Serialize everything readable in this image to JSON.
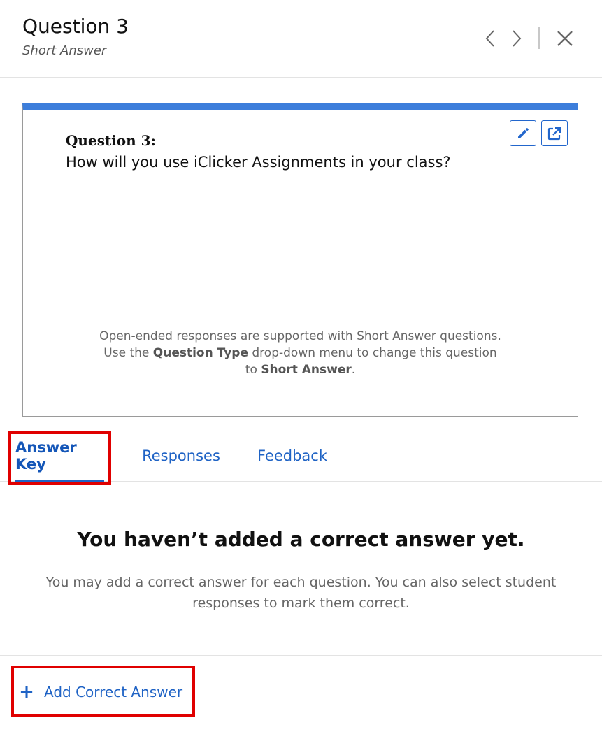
{
  "header": {
    "title": "Question 3",
    "subtitle": "Short Answer",
    "icons": {
      "prev": "chevron-left-icon",
      "next": "chevron-right-icon",
      "close": "close-icon"
    }
  },
  "preview": {
    "question_label": "Question 3:",
    "question_text": "How will you use iClicker Assignments in your class?",
    "note_line1": "Open-ended responses are supported with Short Answer questions.",
    "note_line2_a": "Use the ",
    "note_line2_b": "Question Type",
    "note_line2_c": " drop-down menu to change this question",
    "note_line3_a": "to ",
    "note_line3_b": "Short Answer",
    "note_line3_c": ".",
    "icons": {
      "edit": "pencil-icon",
      "open": "external-link-icon"
    },
    "accent_color": "#3d7edb"
  },
  "tabs": [
    {
      "label": "Answer Key",
      "active": true
    },
    {
      "label": "Responses",
      "active": false
    },
    {
      "label": "Feedback",
      "active": false
    }
  ],
  "empty_state": {
    "title": "You haven’t added a correct answer yet.",
    "description": "You may add a correct answer for each question. You can also select student responses to mark them correct."
  },
  "footer": {
    "add_label": "Add Correct Answer",
    "add_icon": "plus-icon"
  },
  "colors": {
    "link": "#1f63c5",
    "highlight": "#e00000"
  }
}
